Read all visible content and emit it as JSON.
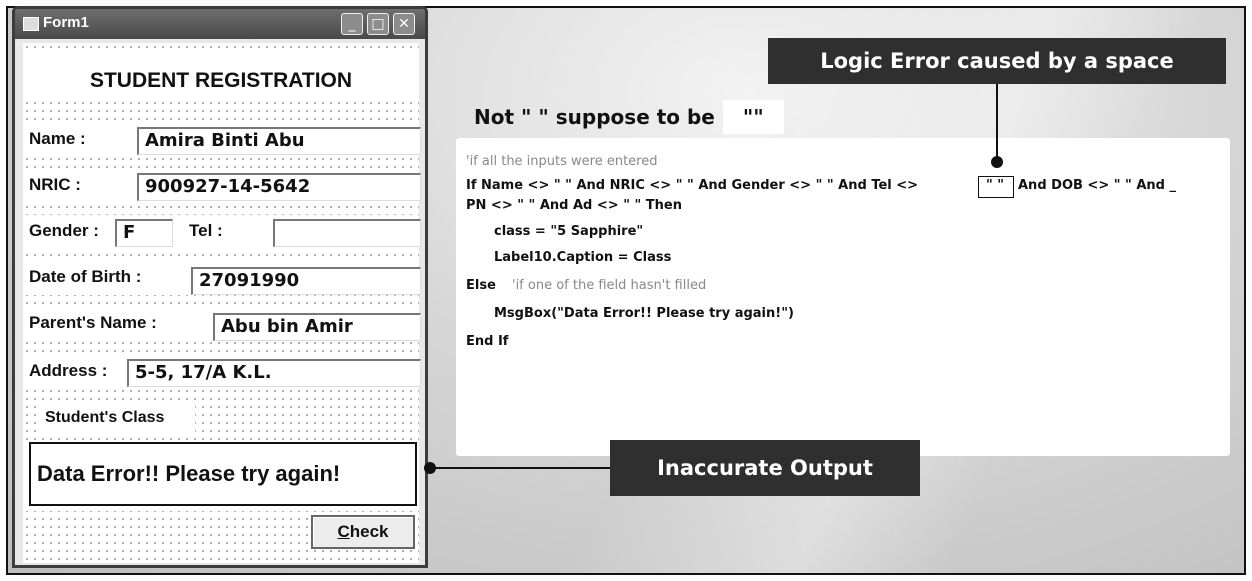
{
  "form": {
    "title": "Form1",
    "window_buttons": {
      "minimize": "_",
      "maximize": "□",
      "close": "✕"
    },
    "heading": "STUDENT REGISTRATION",
    "fields": {
      "name_label": "Name :",
      "name_value": "Amira Binti Abu",
      "nric_label": "NRIC :",
      "nric_value": "900927-14-5642",
      "gender_label": "Gender :",
      "gender_value": "F",
      "tel_label": "Tel :",
      "tel_value": "",
      "dob_label": "Date of Birth :",
      "dob_value": "27091990",
      "parent_label": "Parent's Name :",
      "parent_value": "Abu bin Amir",
      "address_label": "Address :",
      "address_value": "5-5, 17/A K.L.",
      "class_label": "Student's Class"
    },
    "output_text": "Data Error!! Please try again!",
    "check_button": {
      "access_key": "C",
      "rest": "heck"
    }
  },
  "annotations": {
    "logic_error": "Logic Error caused by a space",
    "inaccurate_output": "Inaccurate Output",
    "not_prefix": "Not \"   \" suppose to be",
    "correct_quotes": "\"\""
  },
  "code": {
    "line1_comment": "'if all the inputs were entered",
    "line2a": "If Name <> \" \" And NRIC <> \" \" And Gender <> \" \" And Tel <>",
    "line2_space": "\"  \"",
    "line2b": "And DOB <> \" \" And _",
    "line3": "PN <> \" \"  And Ad <> \" \" Then",
    "line4": "class = \"5 Sapphire\"",
    "line5": "Label10.Caption = Class",
    "line6_else": "Else",
    "line6_comment": "'if one of the field hasn't filled",
    "line7": "MsgBox(\"Data Error!! Please try again!\")",
    "line8": "End If"
  },
  "colors": {
    "callout_bg": "#2f2f2f",
    "callout_text": "#ffffff",
    "comment_text": "#888888"
  },
  "icons": [
    "form-icon",
    "minimize-icon",
    "maximize-icon",
    "close-icon"
  ]
}
